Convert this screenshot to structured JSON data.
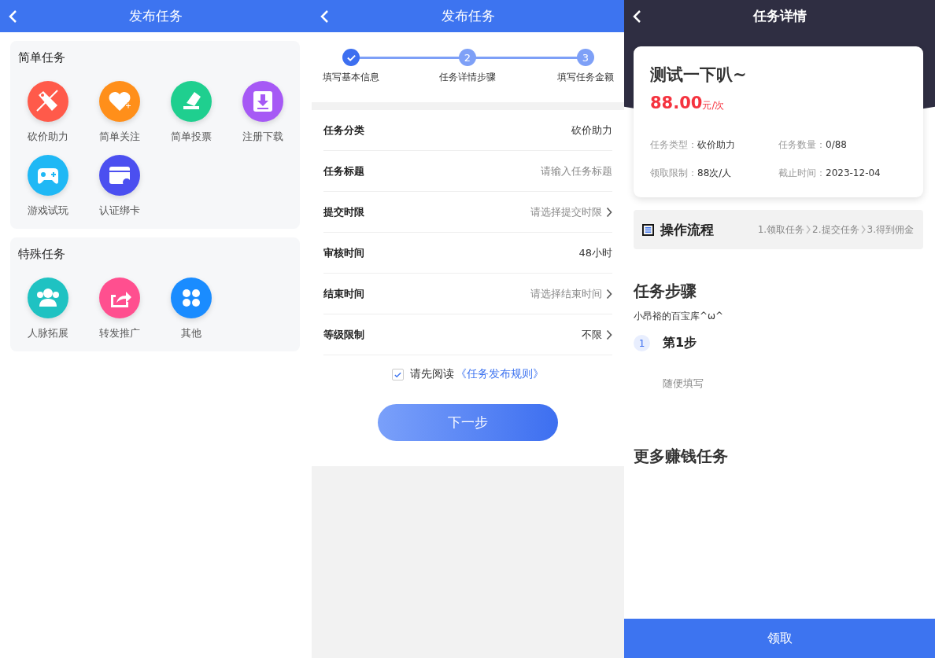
{
  "publish_panel": {
    "title": "发布任务",
    "sections": [
      {
        "title": "简单任务",
        "items": [
          {
            "label": "砍价助力",
            "kind": "tag",
            "color": "#ff5a4a"
          },
          {
            "label": "简单关注",
            "kind": "heart",
            "color": "#ff8f1a"
          },
          {
            "label": "简单投票",
            "kind": "vote",
            "color": "#1fcf8f"
          },
          {
            "label": "注册下载",
            "kind": "download",
            "color": "#a659f5"
          },
          {
            "label": "游戏试玩",
            "kind": "gamepad",
            "color": "#1fb8f5"
          },
          {
            "label": "认证绑卡",
            "kind": "card",
            "color": "#4b4ff0"
          }
        ]
      },
      {
        "title": "特殊任务",
        "items": [
          {
            "label": "人脉拓展",
            "kind": "people",
            "color": "#1fc2c2"
          },
          {
            "label": "转发推广",
            "kind": "share",
            "color": "#ff4f8f"
          },
          {
            "label": "其他",
            "kind": "clover",
            "color": "#1a8cff"
          }
        ]
      }
    ]
  },
  "form_panel": {
    "title": "发布任务",
    "steps": [
      {
        "label": "填写基本信息",
        "done": true
      },
      {
        "number": "2",
        "label": "任务详情步骤",
        "done": false
      },
      {
        "number": "3",
        "label": "填写任务金额",
        "done": false
      }
    ],
    "fields": [
      {
        "label": "任务分类",
        "value": "砍价助力",
        "chevron": false
      },
      {
        "label": "任务标题",
        "placeholder": "请输入任务标题",
        "chevron": false
      },
      {
        "label": "提交时限",
        "placeholder": "请选择提交时限",
        "chevron": true
      },
      {
        "label": "审核时间",
        "value": "48小时",
        "chevron": false
      },
      {
        "label": "结束时间",
        "placeholder": "请选择结束时间",
        "chevron": true
      },
      {
        "label": "等级限制",
        "value": "不限",
        "chevron": true
      }
    ],
    "agreement": {
      "checked": true,
      "text": "请先阅读",
      "link": "《任务发布规则》"
    },
    "next_button": "下一步"
  },
  "detail_panel": {
    "title": "任务详情",
    "task": {
      "title": "测试一下叭~",
      "price": "88.00",
      "unit": "元/次",
      "meta": [
        {
          "label": "任务类型：",
          "value": "砍价助力"
        },
        {
          "label": "任务数量：",
          "value": "0/88"
        },
        {
          "label": "领取限制：",
          "value": "88次/人"
        },
        {
          "label": "截止时间：",
          "value": "2023-12-04"
        }
      ]
    },
    "flow": {
      "title": "操作流程",
      "steps": [
        "1.领取任务",
        "2.提交任务",
        "3.得到佣金"
      ]
    },
    "task_steps": {
      "title": "任务步骤",
      "subtitle": "小昂裕的百宝库^ω^",
      "steps": [
        {
          "number": "1",
          "title": "第1步",
          "body": "随便填写"
        }
      ]
    },
    "more_title": "更多赚钱任务",
    "action_button": "领取"
  }
}
